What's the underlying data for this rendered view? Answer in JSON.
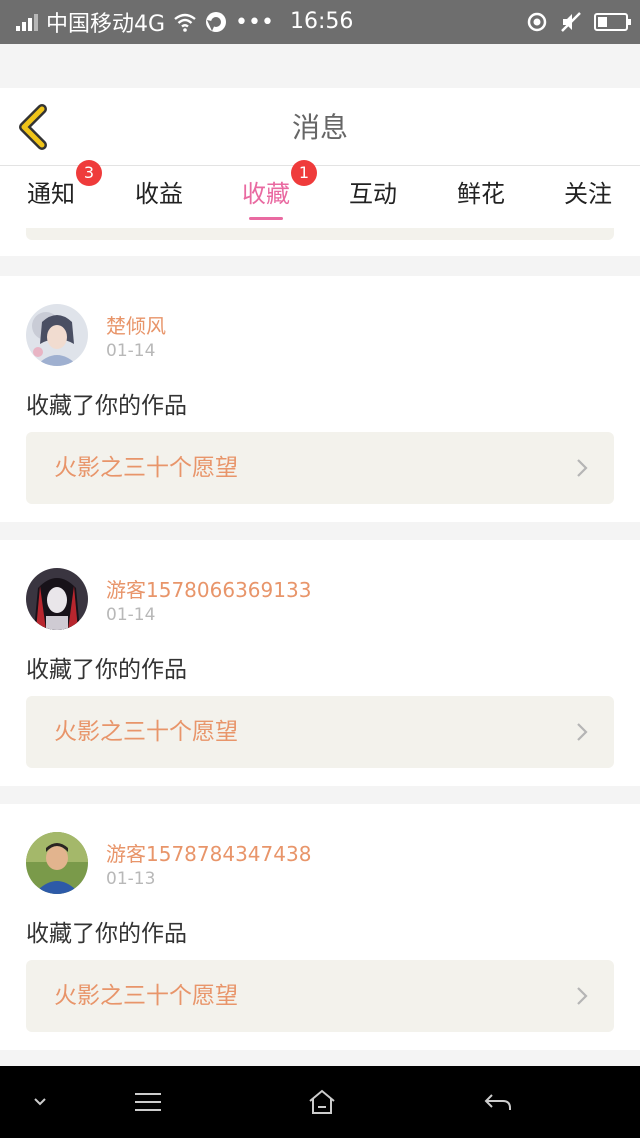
{
  "status_bar": {
    "carrier": "中国移动4G",
    "time": "16:56",
    "more": "•••",
    "icons": [
      "signal-icon",
      "wifi-icon",
      "browser-icon",
      "location-icon",
      "mute-icon",
      "battery-icon"
    ],
    "battery_level": 0.35
  },
  "header": {
    "title": "消息",
    "back_icon": "chevron-left-icon",
    "back_color": "#f0c419"
  },
  "tabs": [
    {
      "label": "通知",
      "badge": "3"
    },
    {
      "label": "收益",
      "badge": null
    },
    {
      "label": "收藏",
      "badge": "1",
      "active": true
    },
    {
      "label": "互动",
      "badge": null
    },
    {
      "label": "鲜花",
      "badge": null
    },
    {
      "label": "关注",
      "badge": null
    }
  ],
  "colors": {
    "accent": "#e96aa1",
    "name": "#e8956a",
    "badge": "#ef3b3b",
    "work_bg": "#f3f2ec"
  },
  "messages": [
    {
      "username": "楚倾风",
      "date": "01-14",
      "action": "收藏了你的作品",
      "work_title": "火影之三十个愿望"
    },
    {
      "username": "游客1578066369133",
      "date": "01-14",
      "action": "收藏了你的作品",
      "work_title": "火影之三十个愿望"
    },
    {
      "username": "游客1578784347438",
      "date": "01-13",
      "action": "收藏了你的作品",
      "work_title": "火影之三十个愿望"
    }
  ],
  "nav_bar": {
    "icons": [
      "chevron-down-icon",
      "menu-icon",
      "home-icon",
      "back-arrow-icon"
    ]
  }
}
